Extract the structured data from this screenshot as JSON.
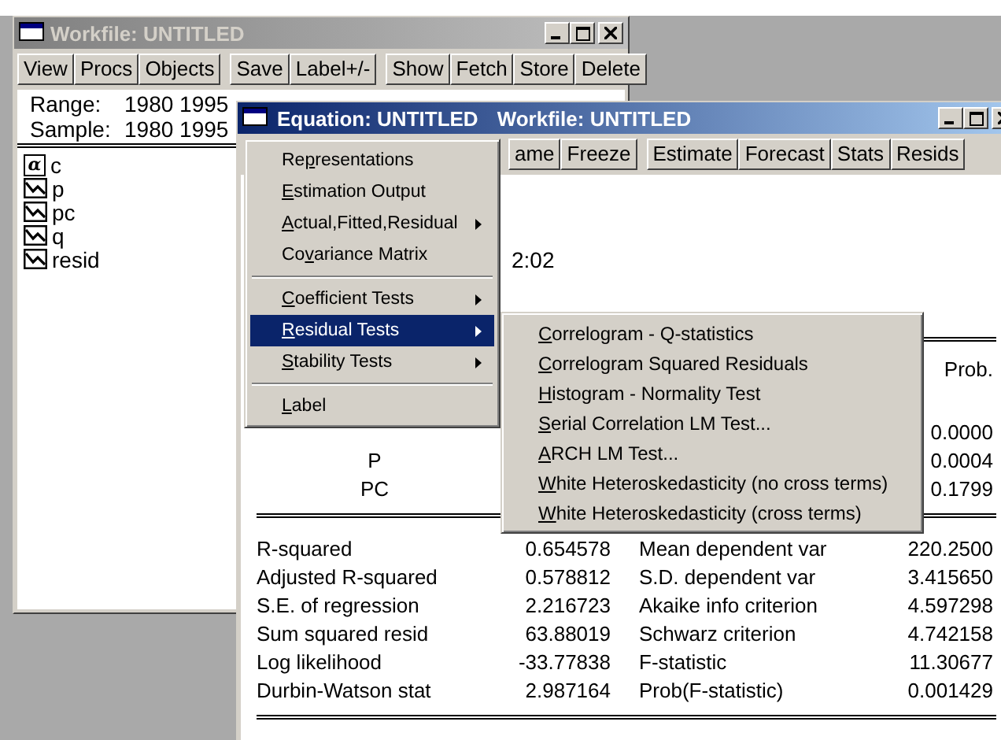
{
  "workfile": {
    "title": "Workfile: UNTITLED",
    "active": false,
    "toolbar": [
      [
        "View",
        "Procs",
        "Objects"
      ],
      [
        "Save",
        "Label+/-"
      ],
      [
        "Show",
        "Fetch",
        "Store",
        "Delete"
      ]
    ],
    "range": {
      "label": "Range:",
      "value": "1980 1995"
    },
    "sample": {
      "label": "Sample:",
      "value": "1980 1995"
    },
    "objects": [
      {
        "name": "c",
        "kind": "coefficient",
        "icon_text": "α"
      },
      {
        "name": "p",
        "kind": "series"
      },
      {
        "name": "pc",
        "kind": "series"
      },
      {
        "name": "q",
        "kind": "series"
      },
      {
        "name": "resid",
        "kind": "series"
      }
    ]
  },
  "equation": {
    "title": "Equation: UNTITLED",
    "subtitle": "Workfile: UNTITLED",
    "active": true,
    "toolbar": [
      [
        "ame",
        "Freeze"
      ],
      [
        "Estimate",
        "Forecast",
        "Stats",
        "Resids"
      ]
    ],
    "time_fragment": "2:02",
    "coef_header": "Prob.",
    "coef_rows": [
      {
        "prob": "0.0000"
      },
      {
        "variable": "P",
        "prob": "0.0004"
      },
      {
        "variable": "PC",
        "prob": "0.1799"
      }
    ],
    "stats": [
      {
        "label": "R-squared",
        "value": "0.654578",
        "label2": "Mean dependent var",
        "value2": "220.2500"
      },
      {
        "label": "Adjusted R-squared",
        "value": "0.578812",
        "label2": "S.D. dependent var",
        "value2": "3.415650"
      },
      {
        "label": "S.E. of regression",
        "value": "2.216723",
        "label2": "Akaike info criterion",
        "value2": "4.597298"
      },
      {
        "label": "Sum squared resid",
        "value": "63.88019",
        "label2": "Schwarz criterion",
        "value2": "4.742158"
      },
      {
        "label": "Log likelihood",
        "value": "-33.77838",
        "label2": "F-statistic",
        "value2": "11.30677"
      },
      {
        "label": "Durbin-Watson stat",
        "value": "2.987164",
        "label2": "Prob(F-statistic)",
        "value2": "0.001429"
      }
    ]
  },
  "menu": {
    "items": [
      {
        "kind": "item",
        "pre": "Re",
        "key": "p",
        "post": "resentations",
        "submenu": false,
        "selected": false
      },
      {
        "kind": "item",
        "key": "E",
        "post": "stimation Output",
        "submenu": false,
        "selected": false
      },
      {
        "kind": "item",
        "key": "A",
        "post": "ctual,Fitted,Residual",
        "submenu": true,
        "selected": false
      },
      {
        "kind": "item",
        "pre": "Co",
        "key": "v",
        "post": "ariance Matrix",
        "submenu": false,
        "selected": false
      },
      {
        "kind": "separator"
      },
      {
        "kind": "item",
        "key": "C",
        "post": "oefficient Tests",
        "submenu": true,
        "selected": false
      },
      {
        "kind": "item",
        "key": "R",
        "post": "esidual Tests",
        "submenu": true,
        "selected": true
      },
      {
        "kind": "item",
        "key": "S",
        "post": "tability Tests",
        "submenu": true,
        "selected": false
      },
      {
        "kind": "separator"
      },
      {
        "kind": "item",
        "key": "L",
        "post": "abel",
        "submenu": false,
        "selected": false
      }
    ]
  },
  "submenu": {
    "items": [
      {
        "kind": "item",
        "key": "C",
        "post": "orrelogram - Q-statistics",
        "submenu": false,
        "selected": false
      },
      {
        "kind": "item",
        "key": "C",
        "post": "orrelogram Squared Residuals",
        "submenu": false,
        "selected": false
      },
      {
        "kind": "item",
        "key": "H",
        "post": "istogram - Normality Test",
        "submenu": false,
        "selected": false
      },
      {
        "kind": "item",
        "key": "S",
        "post": "erial Correlation LM Test...",
        "submenu": false,
        "selected": false
      },
      {
        "kind": "item",
        "key": "A",
        "post": "RCH LM Test...",
        "submenu": false,
        "selected": false
      },
      {
        "kind": "item",
        "key": "W",
        "post": "hite Heteroskedasticity (no cross terms)",
        "submenu": false,
        "selected": false
      },
      {
        "kind": "item",
        "key": "W",
        "post": "hite Heteroskedasticity (cross terms)",
        "submenu": false,
        "selected": false
      }
    ]
  }
}
